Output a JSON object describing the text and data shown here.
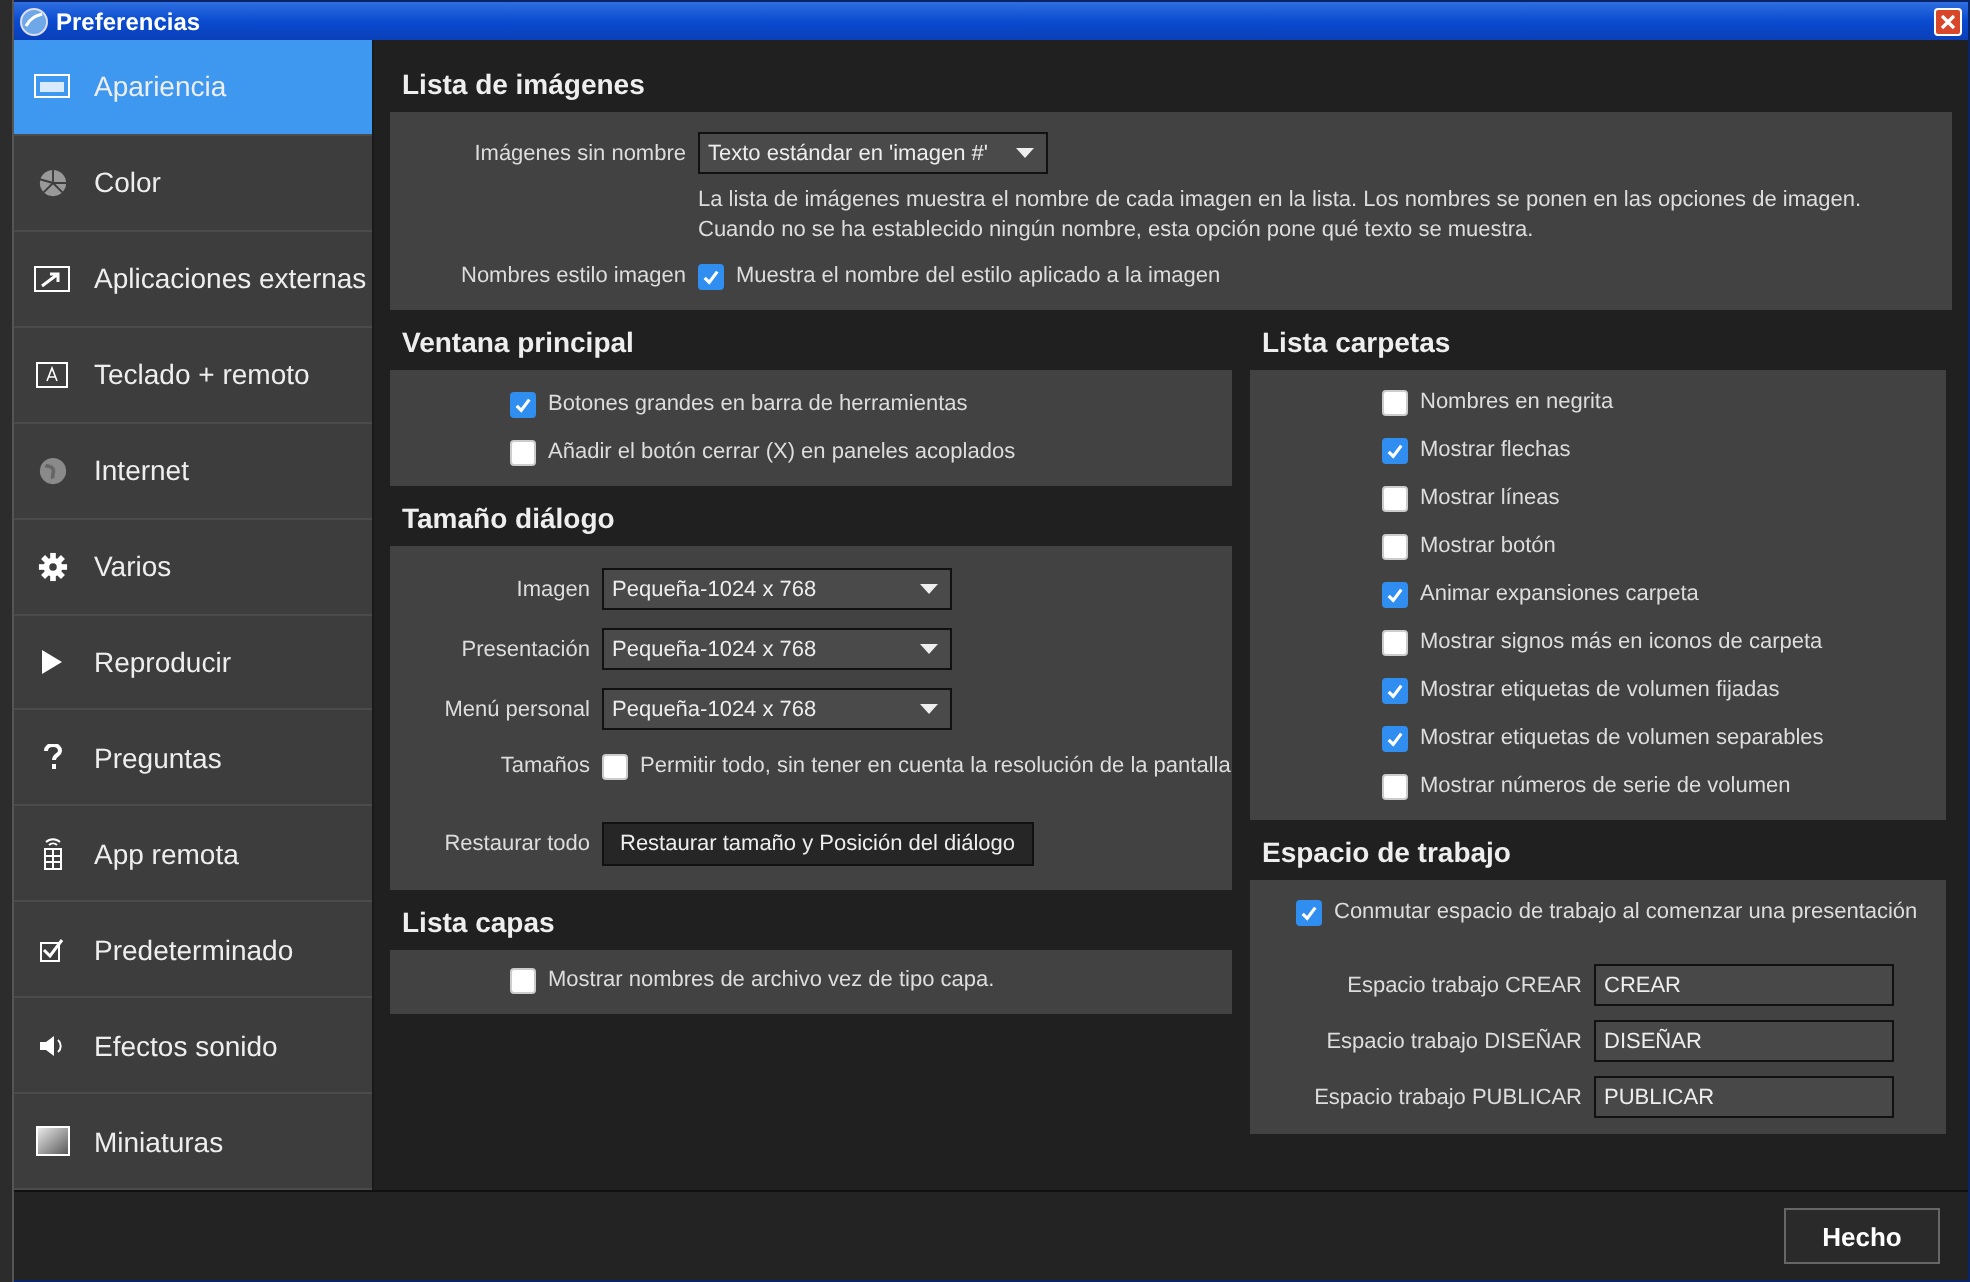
{
  "window": {
    "title": "Preferencias"
  },
  "sidebar": {
    "items": [
      {
        "label": "Apariencia",
        "selected": true
      },
      {
        "label": "Color",
        "selected": false
      },
      {
        "label": "Aplicaciones externas",
        "selected": false
      },
      {
        "label": "Teclado + remoto",
        "selected": false
      },
      {
        "label": "Internet",
        "selected": false
      },
      {
        "label": "Varios",
        "selected": false
      },
      {
        "label": "Reproducir",
        "selected": false
      },
      {
        "label": "Preguntas",
        "selected": false
      },
      {
        "label": "App remota",
        "selected": false
      },
      {
        "label": "Predeterminado",
        "selected": false
      },
      {
        "label": "Efectos sonido",
        "selected": false
      },
      {
        "label": "Miniaturas",
        "selected": false
      }
    ]
  },
  "lista_imagenes": {
    "title": "Lista de imágenes",
    "unnamed_label": "Imágenes sin nombre",
    "unnamed_value": "Texto estándar en 'imagen #'",
    "description": "La lista de imágenes muestra el nombre de cada imagen en la lista. Los nombres se ponen en las opciones de imagen. Cuando no se ha establecido ningún nombre, esta opción pone qué texto se muestra.",
    "style_label": "Nombres estilo imagen",
    "style_option": {
      "label": "Muestra el nombre del estilo aplicado a la imagen",
      "checked": true
    }
  },
  "ventana_principal": {
    "title": "Ventana principal",
    "options": [
      {
        "label": "Botones grandes en barra de herramientas",
        "checked": true
      },
      {
        "label": "Añadir el botón cerrar (X) en paneles acoplados",
        "checked": false
      }
    ]
  },
  "tamano_dialogo": {
    "title": "Tamaño diálogo",
    "selects": [
      {
        "label": "Imagen",
        "value": "Pequeña-1024 x 768"
      },
      {
        "label": "Presentación",
        "value": "Pequeña-1024 x 768"
      },
      {
        "label": "Menú personal",
        "value": "Pequeña-1024 x 768"
      }
    ],
    "sizes_label": "Tamaños",
    "sizes_option": {
      "label": "Permitir todo, sin tener en cuenta la resolución de la pantalla",
      "checked": false
    },
    "restore_label": "Restaurar todo",
    "restore_button": "Restaurar tamaño y Posición del diálogo"
  },
  "lista_capas": {
    "title": "Lista capas",
    "options": [
      {
        "label": "Mostrar nombres de archivo vez de tipo capa.",
        "checked": false
      }
    ]
  },
  "lista_carpetas": {
    "title": "Lista carpetas",
    "options": [
      {
        "label": "Nombres en negrita",
        "checked": false
      },
      {
        "label": "Mostrar flechas",
        "checked": true
      },
      {
        "label": "Mostrar líneas",
        "checked": false
      },
      {
        "label": "Mostrar botón",
        "checked": false
      },
      {
        "label": "Animar expansiones carpeta",
        "checked": true
      },
      {
        "label": "Mostrar signos más en iconos de carpeta",
        "checked": false
      },
      {
        "label": "Mostrar etiquetas de volumen fijadas",
        "checked": true
      },
      {
        "label": "Mostrar etiquetas de volumen separables",
        "checked": true
      },
      {
        "label": "Mostrar números de serie de volumen",
        "checked": false
      }
    ]
  },
  "espacio_trabajo": {
    "title": "Espacio de trabajo",
    "switch_option": {
      "label": "Conmutar espacio de trabajo al comenzar una presentación",
      "checked": true
    },
    "fields": [
      {
        "label": "Espacio trabajo CREAR",
        "value": "CREAR"
      },
      {
        "label": "Espacio trabajo DISEÑAR",
        "value": "DISEÑAR"
      },
      {
        "label": "Espacio trabajo PUBLICAR",
        "value": "PUBLICAR"
      }
    ]
  },
  "footer": {
    "done_button": "Hecho"
  }
}
